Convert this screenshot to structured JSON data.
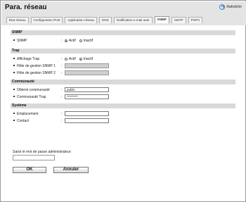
{
  "header": {
    "title": "Para. réseau",
    "refresh_label": "Rafraîchir"
  },
  "tabs": [
    {
      "label": "État réseau",
      "active": false
    },
    {
      "label": "Configuration IPv6",
      "active": false
    },
    {
      "label": "Application réseau",
      "active": false
    },
    {
      "label": "DNS",
      "active": false
    },
    {
      "label": "Notification e-mail auto",
      "active": false
    },
    {
      "label": "SNMP",
      "active": true
    },
    {
      "label": "SMTP",
      "active": false
    },
    {
      "label": "POP3",
      "active": false
    }
  ],
  "snmp": {
    "heading": "SNMP",
    "snmp_row": {
      "label": "SNMP",
      "colon": ":",
      "option_on": "Actif",
      "option_off": "Inactif",
      "selected": "Actif"
    }
  },
  "trap": {
    "heading": "Trap",
    "affichage": {
      "label": "Affichage Trap",
      "colon": ":",
      "option_on": "Actif",
      "option_off": "Inactif",
      "selected": "Inactif"
    },
    "host1": {
      "label": "Hôte de gestion SNMP 1",
      "colon": ":",
      "value": ""
    },
    "host2": {
      "label": "Hôte de gestion SNMP 2",
      "colon": ":",
      "value": ""
    }
  },
  "communaute": {
    "heading": "Communauté",
    "obtenir": {
      "label": "Obtenir communauté",
      "colon": ":",
      "value": "public"
    },
    "trap": {
      "label": "Communauté Trap",
      "colon": ":",
      "value": "*********"
    }
  },
  "systeme": {
    "heading": "Système",
    "emplacement": {
      "label": "Emplacement",
      "colon": ":",
      "value": ""
    },
    "contact": {
      "label": "Contact",
      "colon": ":",
      "value": ""
    }
  },
  "admin": {
    "label": "Saisir le mot de passe administrateur:",
    "value": ""
  },
  "buttons": {
    "ok_label": "OK",
    "cancel_label": "Annuler"
  }
}
